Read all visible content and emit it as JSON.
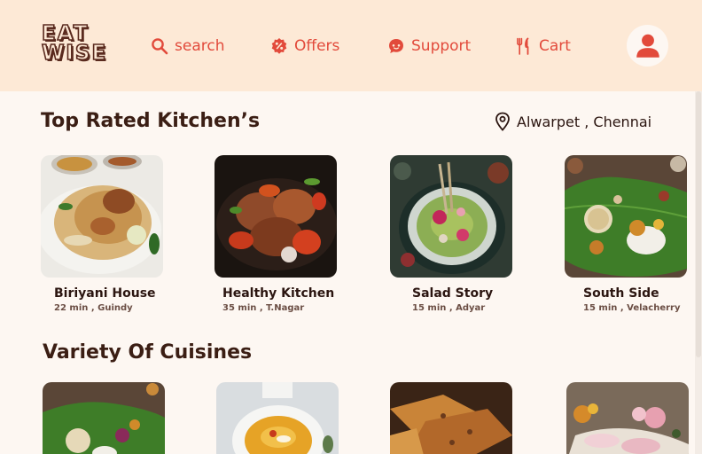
{
  "header": {
    "logo": [
      "EAT",
      "WISE"
    ],
    "nav": {
      "search": "search",
      "offers": "Offers",
      "support": "Support",
      "cart": "Cart"
    }
  },
  "top_rated": {
    "title": "Top Rated Kitchen’s",
    "location": "Alwarpet , Chennai",
    "kitchens": [
      {
        "name": "Biriyani House",
        "meta": "22 min , Guindy"
      },
      {
        "name": "Healthy Kitchen",
        "meta": "35 min , T.Nagar"
      },
      {
        "name": "Salad Story",
        "meta": "15 min , Adyar"
      },
      {
        "name": "South Side",
        "meta": "15 min , Velacherry"
      }
    ]
  },
  "cuisines": {
    "title": "Variety Of Cuisines"
  },
  "colors": {
    "header_bg": "#fde9d6",
    "accent": "#e24a3b",
    "text_dark": "#3b1e14",
    "page_bg": "#fdf7f2"
  },
  "icons": [
    "search-icon",
    "offer-percent-icon",
    "support-chat-icon",
    "fork-knife-icon",
    "user-icon",
    "location-pin-icon"
  ]
}
